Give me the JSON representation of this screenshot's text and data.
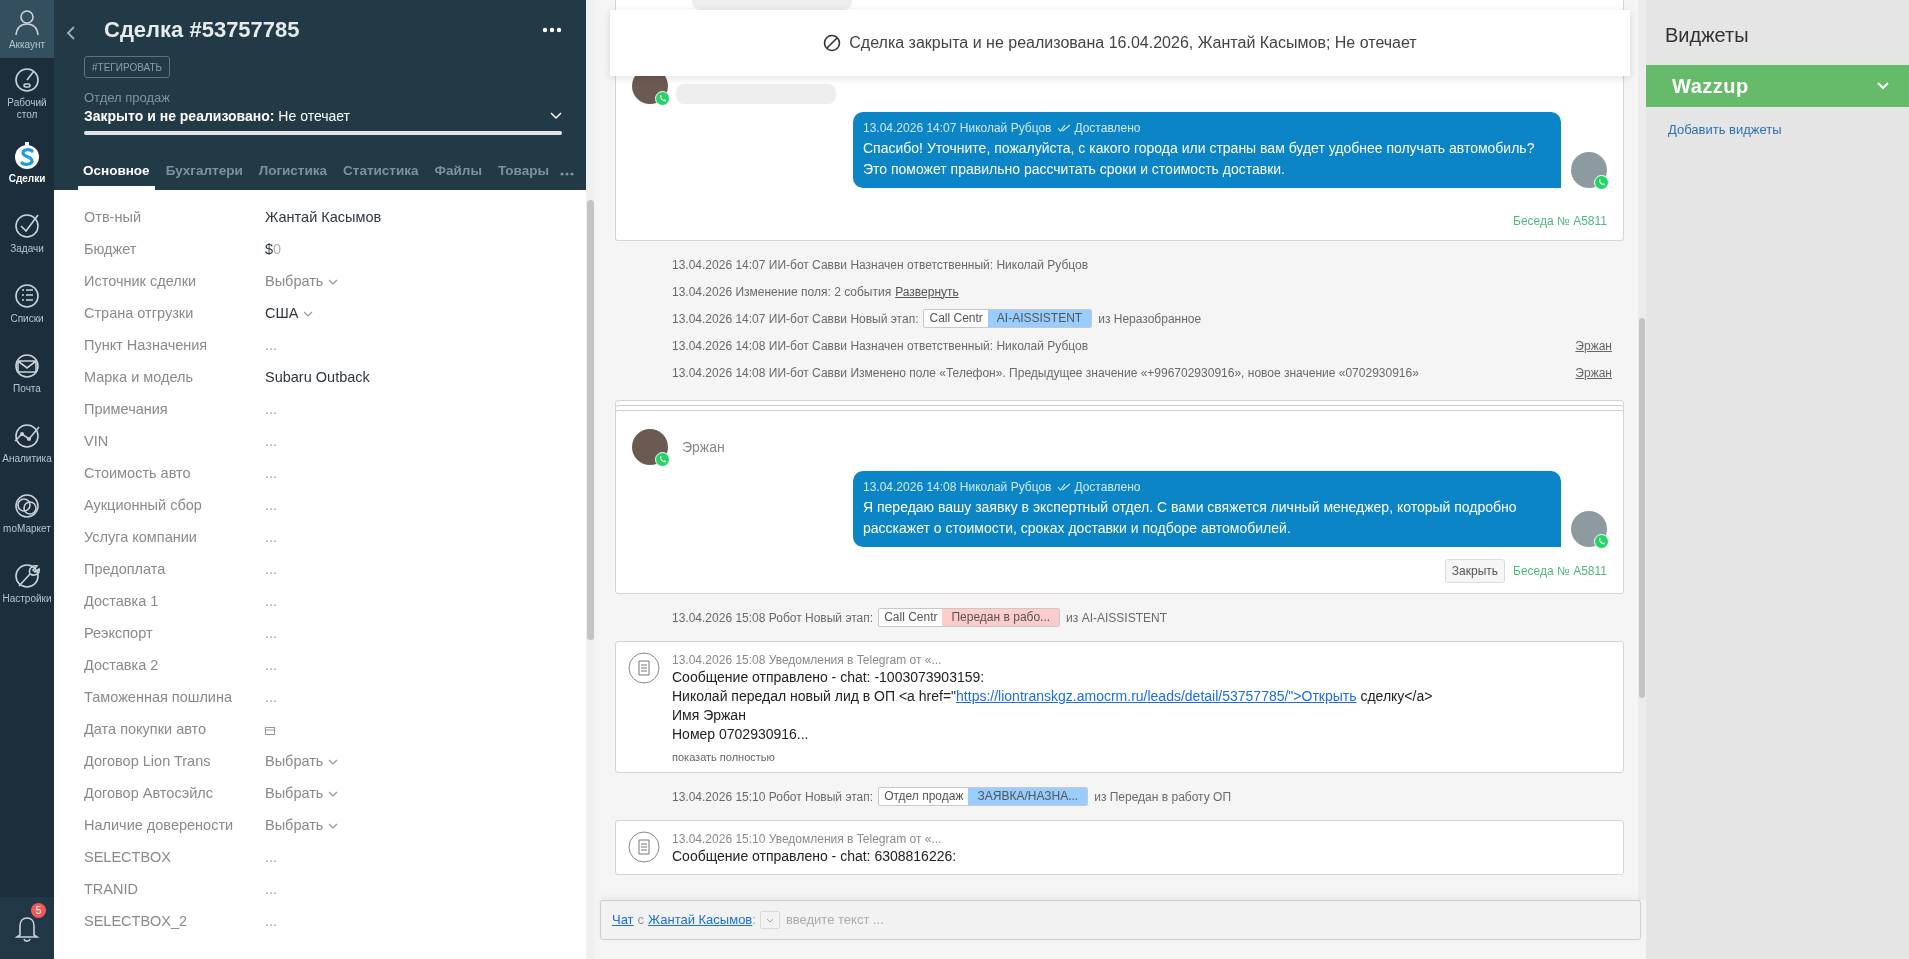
{
  "nav": {
    "items": [
      {
        "label": "Аккаунт",
        "selected": false
      },
      {
        "label": "Рабочий стол",
        "selected": false
      },
      {
        "label": "Сделки",
        "selected": true
      },
      {
        "label": "Задачи",
        "selected": false
      },
      {
        "label": "Списки",
        "selected": false
      },
      {
        "label": "Почта",
        "selected": false
      },
      {
        "label": "Аналитика",
        "selected": false
      },
      {
        "label": "moМаркет",
        "selected": false
      },
      {
        "label": "Настройки",
        "selected": false
      }
    ],
    "notifications": "5"
  },
  "lead": {
    "title": "Сделка #53757785",
    "tag_button": "#ТЕГИРОВАТЬ",
    "pipeline": "Отдел продаж",
    "status": {
      "label": "Закрыто и не реализовано:",
      "value": "Не отечает",
      "level": 1
    },
    "tabs": [
      {
        "label": "Основное",
        "selected": true
      },
      {
        "label": "Бухгалтери",
        "selected": false
      },
      {
        "label": "Логистика",
        "selected": false
      },
      {
        "label": "Статистика",
        "selected": false
      },
      {
        "label": "Файлы",
        "selected": false
      },
      {
        "label": "Товары",
        "selected": false
      }
    ],
    "fields": [
      {
        "label": "Отв-ный",
        "kind": "text",
        "value": "Жантай Касымов"
      },
      {
        "label": "Бюджет",
        "kind": "money",
        "currency": "$",
        "value": "0"
      },
      {
        "label": "Источник сделки",
        "kind": "select",
        "placeholder": "Выбрать"
      },
      {
        "label": "Страна отгрузки",
        "kind": "select_set",
        "value": "США"
      },
      {
        "label": "Пункт Назначения",
        "kind": "empty",
        "value": "..."
      },
      {
        "label": "Марка и модель",
        "kind": "text",
        "value": "Subaru Outback"
      },
      {
        "label": "Примечания",
        "kind": "empty",
        "value": "..."
      },
      {
        "label": "VIN",
        "kind": "empty",
        "value": "..."
      },
      {
        "label": "Стоимость авто",
        "kind": "empty",
        "value": "..."
      },
      {
        "label": "Аукционный сбор",
        "kind": "empty",
        "value": "..."
      },
      {
        "label": "Услуга компании",
        "kind": "empty",
        "value": "..."
      },
      {
        "label": "Предоплата",
        "kind": "empty",
        "value": "..."
      },
      {
        "label": "Доставка 1",
        "kind": "empty",
        "value": "..."
      },
      {
        "label": "Реэкспорт",
        "kind": "empty",
        "value": "..."
      },
      {
        "label": "Доставка 2",
        "kind": "empty",
        "value": "..."
      },
      {
        "label": "Таможенная пошлина",
        "kind": "empty",
        "value": "..."
      },
      {
        "label": "Дата покупки авто",
        "kind": "date"
      },
      {
        "label": "Договор Lion Trans",
        "kind": "select",
        "placeholder": "Выбрать"
      },
      {
        "label": "Договор Автосэйлс",
        "kind": "select",
        "placeholder": "Выбрать"
      },
      {
        "label": "Наличие доверености",
        "kind": "select",
        "placeholder": "Выбрать"
      },
      {
        "label": "SELECTBOX",
        "kind": "empty",
        "value": "..."
      },
      {
        "label": "TRANID",
        "kind": "empty",
        "value": "..."
      },
      {
        "label": "SELECTBOX_2",
        "kind": "empty",
        "value": "..."
      }
    ]
  },
  "feed": {
    "banner": "Сделка закрыта и не реализована 16.04.2026, Жантай Касымов; Не отечает",
    "items": [
      {
        "kind": "chat",
        "incoming_bubble": true,
        "stacked": false,
        "message": {
          "meta": "13.04.2026 14:07 Николай Рубцов",
          "status": "Доставлено",
          "text": "Спасибо! Уточните, пожалуйста, с какого города или страны вам будет удобнее получать автомобиль? Это поможет правильно рассчитать сроки и стоимость доставки."
        },
        "conversation": "Беседа № A5811"
      },
      {
        "kind": "event",
        "text": "13.04.2026 14:07 ИИ-бот Савви Назначен ответственный: Николай Рубцов"
      },
      {
        "kind": "event",
        "text": "13.04.2026 Изменение поля: 2 события",
        "link": "Развернуть"
      },
      {
        "kind": "event",
        "text": "13.04.2026 14:07 ИИ-бот Савви Новый этап:",
        "stage": {
          "pipeline": "Call Centr",
          "name": "AI-AISSISTENT",
          "color": "#99ccff"
        },
        "suffix": "из Неразобранное"
      },
      {
        "kind": "event",
        "text": "13.04.2026 14:08 ИИ-бот Савви Назначен ответственный: Николай Рубцов",
        "right_link": "Эржан"
      },
      {
        "kind": "event",
        "text": "13.04.2026 14:08 ИИ-бот Савви Изменено поле «Телефон». Предыдущее значение «+996702930916», новое значение «0702930916»",
        "right_link": "Эржан"
      },
      {
        "kind": "chat",
        "incoming_bubble": false,
        "stacked": true,
        "contact": "Эржан",
        "message": {
          "meta": "13.04.2026 14:08 Николай Рубцов",
          "status": "Доставлено",
          "text": "Я передаю вашу заявку в экспертный отдел. С вами свяжется личный менеджер, который подробно расскажет о стоимости, сроках доставки и подборе автомобилей."
        },
        "close_button": "Закрыть",
        "conversation": "Беседа № A5811"
      },
      {
        "kind": "event",
        "text": "13.04.2026 15:08 Робот Новый этап:",
        "stage": {
          "pipeline": "Call Centr",
          "name": "Передан в рабо...",
          "color": "#ffcccc"
        },
        "suffix": "из AI-AISSISTENT"
      },
      {
        "kind": "note",
        "meta": "13.04.2026 15:08 Уведомления в Telegram от «...",
        "lines": [
          {
            "text": "Сообщение отправлено - chat: -1003073903159:"
          },
          {
            "text": "Николай передал новый лид в ОП <a href=\"",
            "link": "https://liontranskgz.amocrm.ru/leads/detail/53757785/\">Открыть",
            "after": "сделку</a>"
          },
          {
            "text": "Имя Эржан"
          },
          {
            "text": "Номер 0702930916..."
          }
        ],
        "more": "показать полностью"
      },
      {
        "kind": "event",
        "text": "13.04.2026 15:10 Робот Новый этап:",
        "stage": {
          "pipeline": "Отдел продаж",
          "name": "ЗАЯВКА/НАЗНА...",
          "color": "#99ccff"
        },
        "suffix": "из Передан в работу ОП"
      },
      {
        "kind": "note",
        "meta": "13.04.2026 15:10 Уведомления в Telegram от «...",
        "lines": [
          {
            "text": "Сообщение отправлено - chat: 6308816226:"
          }
        ]
      }
    ]
  },
  "chat_bar": {
    "channel_link": "Чат",
    "with": "с",
    "contact_link": "Жантай Касымов",
    "colon": ":",
    "placeholder": "введите текст ..."
  },
  "widgets": {
    "title": "Виджеты",
    "items": [
      {
        "label": "Wazzup"
      }
    ],
    "add_link": "Добавить виджеты"
  }
}
